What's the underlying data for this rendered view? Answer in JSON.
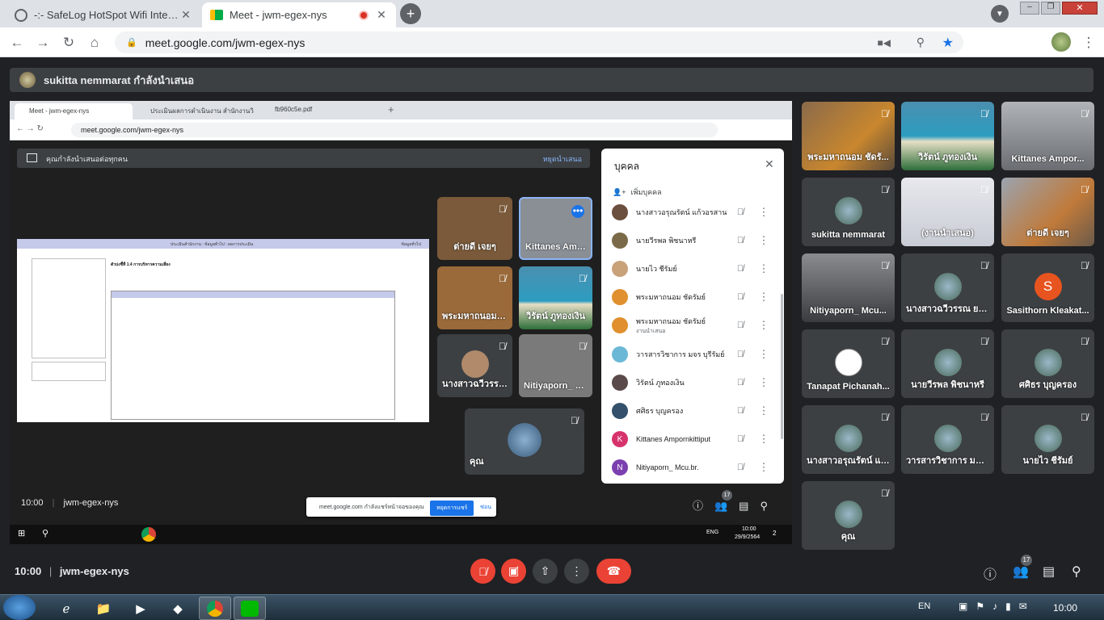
{
  "browser": {
    "tabs": [
      {
        "title": "-:- SafeLog HotSpot Wifi Internet",
        "active": false
      },
      {
        "title": "Meet - jwm-egex-nys",
        "active": true
      }
    ],
    "url": "meet.google.com/jwm-egex-nys"
  },
  "meet": {
    "presenting_banner": "sukitta nemmarat กำลังนำเสนอ",
    "time": "10:00",
    "meeting_code": "jwm-egex-nys",
    "participant_count": "17",
    "grid_tiles": [
      {
        "name": "พระมหาถนอม ชัดรั...",
        "style": "video-monk"
      },
      {
        "name": "วิรัตน์ ภูทองเงิน",
        "style": "video-beach"
      },
      {
        "name": "Kittanes Ampor...",
        "style": "video-man"
      },
      {
        "name": "sukitta nemmarat",
        "style": "avatar-photo"
      },
      {
        "name": "(งานนำเสนอ)",
        "style": "video-screen"
      },
      {
        "name": "ต่ายดี เจยๆ",
        "style": "video-monk2"
      },
      {
        "name": "Nitiyaporn_ Mcu...",
        "style": "video-woman"
      },
      {
        "name": "นางสาวฉวีวรรณ ยอ...",
        "style": "avatar-photo"
      },
      {
        "name": "Sasithorn Kleakat...",
        "style": "avatar-letter",
        "letter": "S",
        "color": "#e8541f"
      },
      {
        "name": "Tanapat Pichanah...",
        "style": "avatar-draw"
      },
      {
        "name": "นายวีรพล พิชนาหรี",
        "style": "avatar-photo"
      },
      {
        "name": "ศศิธร บุญครอง",
        "style": "avatar-photo"
      },
      {
        "name": "นางสาวอรุณรัตน์ แก้...",
        "style": "avatar-photo"
      },
      {
        "name": "วารสารวิชาการ มจร ...",
        "style": "avatar-photo"
      },
      {
        "name": "นายไว ชีรัมย์",
        "style": "avatar-photo"
      },
      {
        "name": "คุณ",
        "style": "avatar-photo"
      }
    ],
    "controls": {
      "time": "10:00",
      "code": "jwm-egex-nys"
    }
  },
  "shared_screen": {
    "tabs": [
      "Meet - jwm-egex-nys",
      "ประเมินผลการดำเนินงาน สำนักงานวิทยา",
      "fb960c5e.pdf"
    ],
    "url": "meet.google.com/jwm-egex-nys",
    "presenting_text": "คุณกำลังนำเสนอต่อทุกคน",
    "stop_presenting": "หยุดนำเสนอ",
    "doc_header_left": "ประเมินสำนักงาน : ข้อมูลทั่วไป : ผลการประเมิน",
    "doc_header_right": "ข้อมูลทั่วไป",
    "doc_title": "ตัวบ่งชี้ที่ 1.4 การบริหารความเสี่ยง",
    "thumb_tiles": [
      {
        "name": "ต่ายดี เจยๆ"
      },
      {
        "name": "Kittanes Ampo..."
      },
      {
        "name": "พระมหาถนอม ชัด..."
      },
      {
        "name": "วิรัตน์ ภูทองเงิน"
      },
      {
        "name": "นางสาวฉวีวรรณ ย..."
      },
      {
        "name": "Nitiyaporn_ Mc..."
      },
      {
        "name": "คุณ"
      }
    ],
    "people_panel": {
      "title": "บุคคล",
      "add_people": "เพิ่มบุคคล",
      "rows": [
        {
          "name": "นางสาวอรุณรัตน์ แก้วอรสาน",
          "sub": "",
          "av": "#6b4f3f"
        },
        {
          "name": "นายวีรพล พิชนาหรี",
          "sub": "",
          "av": "#7a6a48"
        },
        {
          "name": "นายไว ชีรัมย์",
          "sub": "",
          "av": "#c9a27a"
        },
        {
          "name": "พระมหาถนอม ชัดรัมย์",
          "sub": "",
          "av": "#e0902e"
        },
        {
          "name": "พระมหาถนอม ชัดรัมย์",
          "sub": "งานนำเสนอ",
          "av": "#e0902e"
        },
        {
          "name": "วารสารวิชาการ มจร บุรีรัมย์",
          "sub": "",
          "av": "#6bb8d6"
        },
        {
          "name": "วิรัตน์ ภูทองเงิน",
          "sub": "",
          "av": "#5b4a4a"
        },
        {
          "name": "ศศิธร บุญครอง",
          "sub": "",
          "av": "#35506b"
        },
        {
          "name": "Kittanes Ampornkittiput",
          "sub": "",
          "av": "#d6336c",
          "letter": "K"
        },
        {
          "name": "Nitiyaporn_ Mcu.br.",
          "sub": "",
          "av": "#7b3fb0",
          "letter": "N"
        }
      ]
    },
    "bottom_time": "10:00",
    "bottom_code": "jwm-egex-nys",
    "share_notice": "meet.google.com กำลังแชร์หน้าจอของคุณ",
    "share_stop": "หยุดการแชร์",
    "share_hide": "ซ่อน",
    "win_tray_lang": "ENG",
    "win_tray_time": "10:00",
    "win_tray_date": "29/9/2564",
    "win_tray_badge": "2"
  },
  "taskbar": {
    "lang": "EN",
    "time": "10:00"
  }
}
